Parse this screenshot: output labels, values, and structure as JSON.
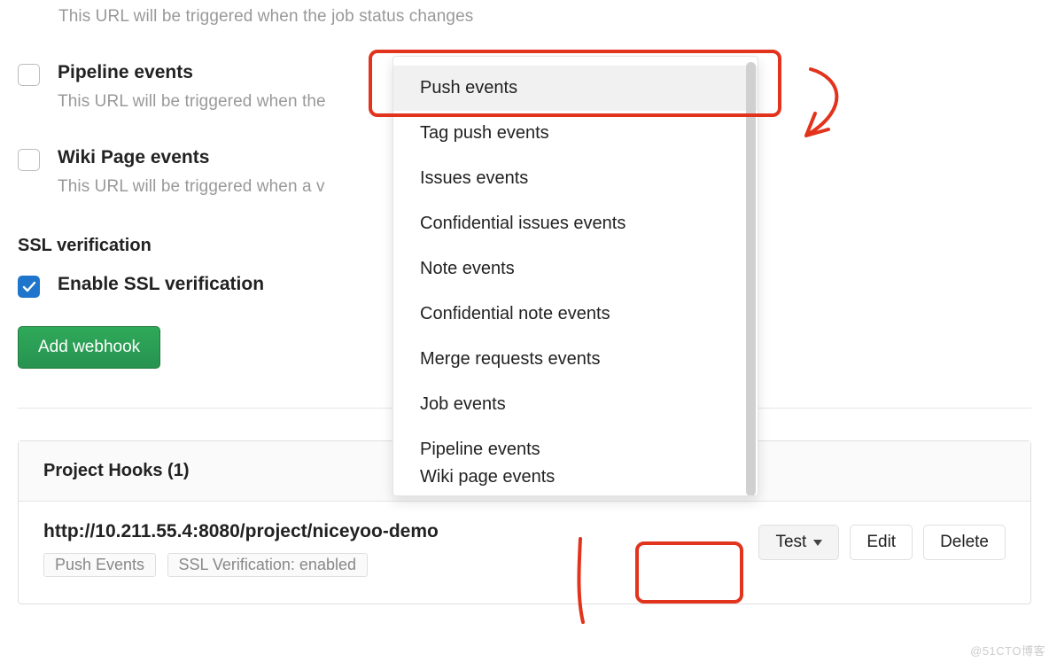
{
  "triggers": {
    "job_desc": "This URL will be triggered when the job status changes",
    "pipeline": {
      "label": "Pipeline events",
      "desc_visible": "This URL will be triggered when the"
    },
    "wiki": {
      "label": "Wiki Page events",
      "desc_visible": "This URL will be triggered when a v"
    }
  },
  "ssl": {
    "title": "SSL verification",
    "enable_label": "Enable SSL verification"
  },
  "buttons": {
    "add_webhook": "Add webhook",
    "test": "Test",
    "edit": "Edit",
    "delete": "Delete"
  },
  "hooks": {
    "title": "Project Hooks (1)",
    "url": "http://10.211.55.4:8080/project/niceyoo-demo",
    "badges": [
      "Push Events",
      "SSL Verification: enabled"
    ]
  },
  "dropdown": {
    "items": [
      "Push events",
      "Tag push events",
      "Issues events",
      "Confidential issues events",
      "Note events",
      "Confidential note events",
      "Merge requests events",
      "Job events",
      "Pipeline events",
      "Wiki page events"
    ]
  },
  "watermark": "@51CTO博客"
}
